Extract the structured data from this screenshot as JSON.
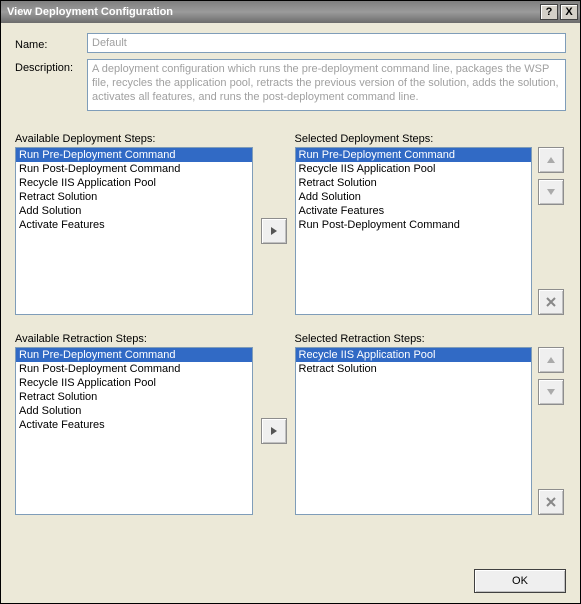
{
  "window": {
    "title": "View Deployment Configuration",
    "help_symbol": "?",
    "close_symbol": "X"
  },
  "form": {
    "name_label": "Name:",
    "name_value": "Default",
    "description_label": "Description:",
    "description_value": "A deployment configuration which runs the pre-deployment command line, packages the WSP file, recycles the application pool, retracts the previous version of the solution, adds the solution, activates all features, and runs the post-deployment command line."
  },
  "deployment": {
    "available_label": "Available Deployment Steps:",
    "selected_label": "Selected Deployment Steps:",
    "available": [
      "Run Pre-Deployment Command",
      "Run Post-Deployment Command",
      "Recycle IIS Application Pool",
      "Retract Solution",
      "Add Solution",
      "Activate Features"
    ],
    "available_selected_index": 0,
    "selected": [
      "Run Pre-Deployment Command",
      "Recycle IIS Application Pool",
      "Retract Solution",
      "Add Solution",
      "Activate Features",
      "Run Post-Deployment Command"
    ],
    "selected_selected_index": 0
  },
  "retraction": {
    "available_label": "Available Retraction Steps:",
    "selected_label": "Selected Retraction Steps:",
    "available": [
      "Run Pre-Deployment Command",
      "Run Post-Deployment Command",
      "Recycle IIS Application Pool",
      "Retract Solution",
      "Add Solution",
      "Activate Features"
    ],
    "available_selected_index": 0,
    "selected": [
      "Recycle IIS Application Pool",
      "Retract Solution"
    ],
    "selected_selected_index": 0
  },
  "buttons": {
    "ok": "OK"
  },
  "icons": {
    "arrow_fill": "#555"
  }
}
